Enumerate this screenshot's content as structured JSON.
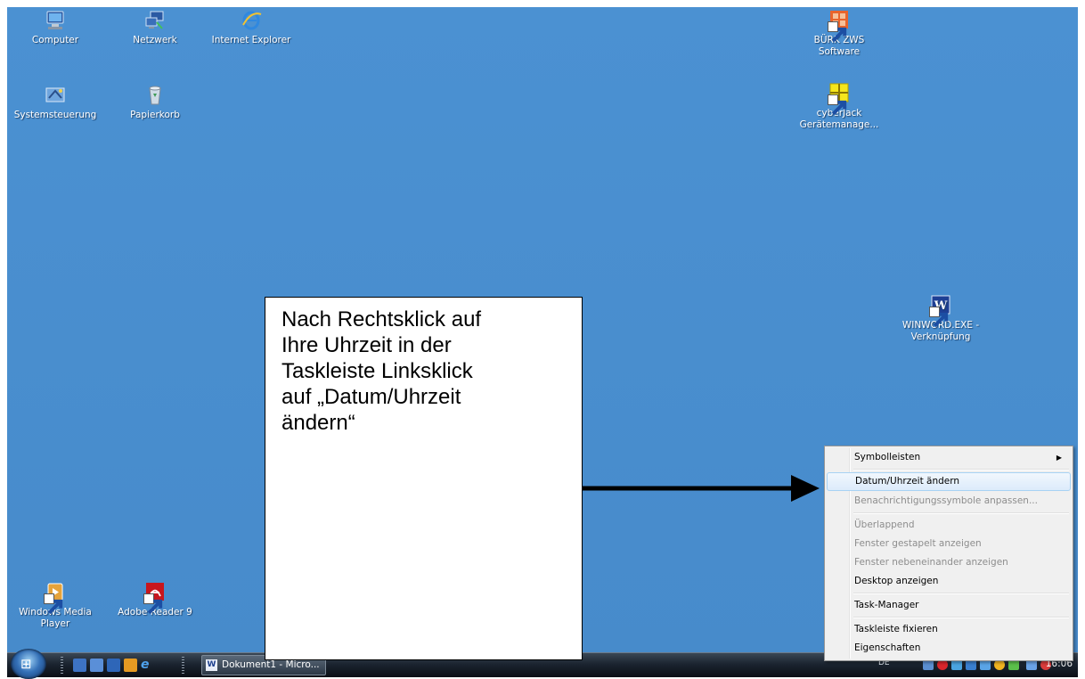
{
  "desktop": {
    "icons": {
      "computer": "Computer",
      "network": "Netzwerk",
      "ie": "Internet Explorer",
      "burk": "BÜRK ZWS Software",
      "control_panel": "Systemsteuerung",
      "recycle_bin": "Papierkorb",
      "cyberjack": "cyberJack Gerätemanage...",
      "winword": "WINWORD.EXE - Verknüpfung",
      "wmp": "Windows Media Player",
      "adobe": "Adobe Reader 9"
    }
  },
  "callout": {
    "text": "Nach Rechtsklick auf\nIhre Uhrzeit in der\nTaskleiste Linksklick\nauf „Datum/Uhrzeit\nändern“"
  },
  "context_menu": {
    "items": [
      {
        "label": "Symbolleisten",
        "state": "submenu"
      },
      {
        "label": "Datum/Uhrzeit ändern",
        "state": "highlighted"
      },
      {
        "label": "Benachrichtigungssymbole anpassen...",
        "state": "disabled"
      },
      {
        "label": "Überlappend",
        "state": "disabled"
      },
      {
        "label": "Fenster gestapelt anzeigen",
        "state": "disabled"
      },
      {
        "label": "Fenster nebeneinander anzeigen",
        "state": "disabled"
      },
      {
        "label": "Desktop anzeigen",
        "state": "enabled"
      },
      {
        "label": "Task-Manager",
        "state": "enabled"
      },
      {
        "label": "Taskleiste fixieren",
        "state": "enabled"
      },
      {
        "label": "Eigenschaften",
        "state": "enabled"
      }
    ]
  },
  "taskbar": {
    "task_button_label": "Dokument1 - Micro...",
    "language": "DE",
    "clock": "16:06"
  },
  "colors": {
    "desktop_bg": "#4a8fcf",
    "menu_highlight_border": "#a8d2f3"
  }
}
